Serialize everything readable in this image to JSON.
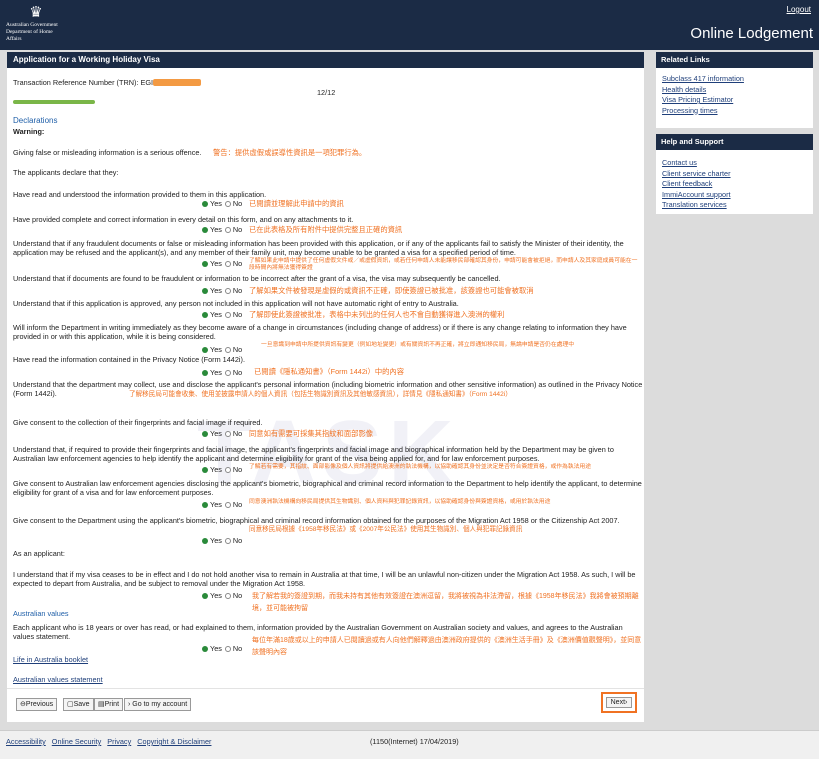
{
  "header": {
    "gov_line1": "Australian Government",
    "gov_line2": "Department of Home Affairs",
    "logout": "Logout",
    "site_title": "Online Lodgement"
  },
  "main": {
    "title": "Application for a Working Holiday Visa",
    "trn_label": "Transaction Reference Number (TRN): EGI",
    "page_counter": "12/12",
    "declarations_heading": "Declarations",
    "warning_label": "Warning:",
    "warning_text": "Giving false or misleading information is a serious offence.",
    "warning_zh": "警告：提供虛假或誤導性資訊是一項犯罪行為。",
    "applicants_declare": "The applicants declare that they:",
    "yes": "Yes",
    "no": "No",
    "q1": "Have read and understood the information provided to them in this application.",
    "q1_zh": "已閱讀並理解此申請中的資訊",
    "q2": "Have provided complete and correct information in every detail on this form, and on any attachments to it.",
    "q2_zh": "已在此表格及所有附件中提供完整且正確的資訊",
    "q3": "Understand that if any fraudulent documents or false or misleading information has been provided with this application, or if any of the applicants fail to satisfy the Minister of their identity, the application may be refused and the applicant(s), and any member of their family unit, may become unable to be granted a visa for a specified period of time.",
    "q3_zh": "了解如果此申請中提供了任何虛假文件或／或虛假資訊，或若任何申請人未能讓移民部確認其身份，申請可能會被拒絕，而申請人及其家庭成員可能在一段時間內將無法獲得簽證",
    "q4": "Understand that if documents are found to be fraudulent or information to be incorrect after the grant of a visa, the visa may subsequently be cancelled.",
    "q4_zh": "了解如果文件被發現是虛假的或資訊不正確，即使簽證已被批准，該簽證也可能會被取消",
    "q5": "Understand that if this application is approved, any person not included in this application will not have automatic right of entry to Australia.",
    "q5_zh": "了解即使此簽證被批准，表格中未列出的任何人也不會自動獲得進入澳洲的權利",
    "q6": "Will inform the Department in writing immediately as they become aware of a change in circumstances (including change of address) or if there is any change relating to information they have provided in or with this application, while it is being considered.",
    "q6_zh": "一旦意識到申請中所提供資訊有變更（例如地址變更）或有關資訊不再正確，將立即通知移民局，無論申請是否仍在處理中",
    "q7": "Have read the information contained in the Privacy Notice (Form 1442i).",
    "q7_zh": "已閱讀《隱私通知書》（Form 1442i）中的內容",
    "q8": "Understand that the department may collect, use and disclose the applicant's personal information (including biometric information and other sensitive information) as outlined in the Privacy Notice (Form 1442i).",
    "q8_zh": "了解移民局可能會收集、使用並披露申請人的個人資訊（包括生物識別資訊及其他敏感資訊），詳情見《隱私通知書》（Form 1442i）",
    "q9": "Give consent to the collection of their fingerprints and facial image if required.",
    "q9_zh": "同意如有需要可採集其指紋和面部影像",
    "q10": "Understand that, if required to provide their fingerprints and facial image, the applicant's fingerprints and facial image and biographical information held by the Department may be given to Australian law enforcement agencies to help identify the applicant and determine eligibility for grant of the visa being applied for, and for law enforcement purposes.",
    "q10_zh": "了解若有需要，其指紋、面部影像及個人資訊將提供給澳洲的執法機構，以協助確認其身份並決定是否符合簽證資格，或作為執法用途",
    "q11": "Give consent to Australian law enforcement agencies disclosing the applicant's biometric, biographical and criminal record information to the Department to help identify the applicant, to determine eligibility for grant of a visa and for law enforcement purposes.",
    "q11_zh": "同意澳洲執法機構向移民局提供其生物識別、個人資料與犯罪記錄資訊，以協助確認身份與簽證資格，或用於執法用途",
    "q12": "Give consent to the Department using the applicant's biometric, biographical and criminal record information obtained for the purposes of the Migration Act 1958 or the Citizenship Act 2007.",
    "q12_zh": "同意移民局根據《1958年移民法》或《2007年公民法》使用其生物識別、個人與犯罪記錄資訊",
    "as_applicant": "As an applicant:",
    "q13": "I understand that if my visa ceases to be in effect and I do not hold another visa to remain in Australia at that time, I will be an unlawful non-citizen under the Migration Act 1958. As such, I will be expected to depart from Australia, and be subject to removal under the Migration Act 1958.",
    "q13_zh": "我了解若我的簽證到期，而我未持有其他有效簽證在澳洲逗留，我將被視為非法滯留，根據《1958年移民法》我將會被預期離境，並可能被拘留",
    "values_heading": "Australian values",
    "q14": "Each applicant who is 18 years or over has read, or had explained to them, information provided by the Australian Government on Australian society and values, and agrees to the Australian values statement.",
    "q14_zh": "每位年滿18歲或以上的申請人已閱讀過或有人向他們解釋過由澳洲政府提供的《澳洲生活手冊》及《澳洲價值觀聲明》，並同意該聲明內容",
    "link_life": "Life in Australia booklet",
    "link_values": "Australian values statement",
    "btn_previous": "Previous",
    "btn_save": "Save",
    "btn_print": "Print",
    "btn_account": "Go to my account",
    "btn_next": "Next"
  },
  "watermark": "TASK",
  "related": {
    "heading": "Related Links",
    "links": [
      "Subclass 417 information",
      "Health details",
      "Visa Pricing Estimator",
      "Processing times"
    ]
  },
  "help": {
    "heading": "Help and Support",
    "links": [
      "Contact us",
      "Client service charter",
      "Client feedback",
      "ImmiAccount support",
      "Translation services"
    ]
  },
  "footer": {
    "links": [
      "Accessibility",
      "Online Security",
      "Privacy",
      "Copyright & Disclaimer"
    ],
    "version": "(1150(Internet) 17/04/2019)"
  },
  "colors": {
    "navy": "#1b2b45",
    "orange": "#f07223",
    "green": "#2a8a3a"
  }
}
